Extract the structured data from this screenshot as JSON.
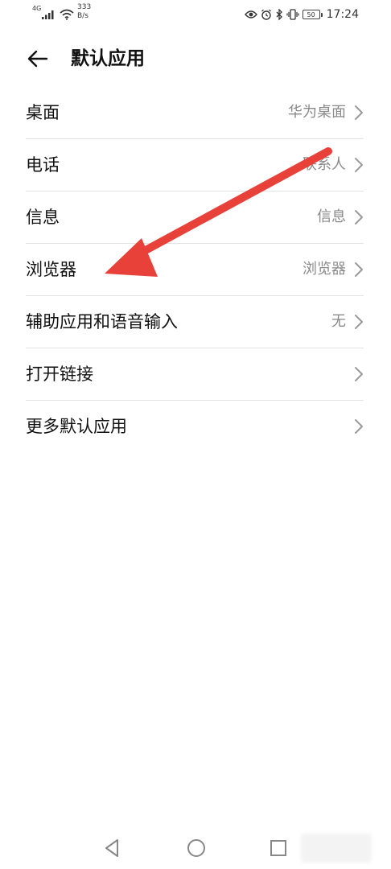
{
  "status_bar": {
    "network_type": "4G",
    "net_speed_value": "333",
    "net_speed_unit": "B/s",
    "battery_level": "50",
    "time": "17:24"
  },
  "header": {
    "title": "默认应用"
  },
  "settings": [
    {
      "label": "桌面",
      "value": "华为桌面"
    },
    {
      "label": "电话",
      "value": "联系人"
    },
    {
      "label": "信息",
      "value": "信息"
    },
    {
      "label": "浏览器",
      "value": "浏览器"
    },
    {
      "label": "辅助应用和语音输入",
      "value": "无"
    },
    {
      "label": "打开链接",
      "value": ""
    },
    {
      "label": "更多默认应用",
      "value": ""
    }
  ],
  "annotation": {
    "arrow_color": "#e8413a"
  },
  "nav_bar": {
    "icons": [
      "back-triangle-icon",
      "home-circle-icon",
      "recents-square-icon"
    ]
  }
}
